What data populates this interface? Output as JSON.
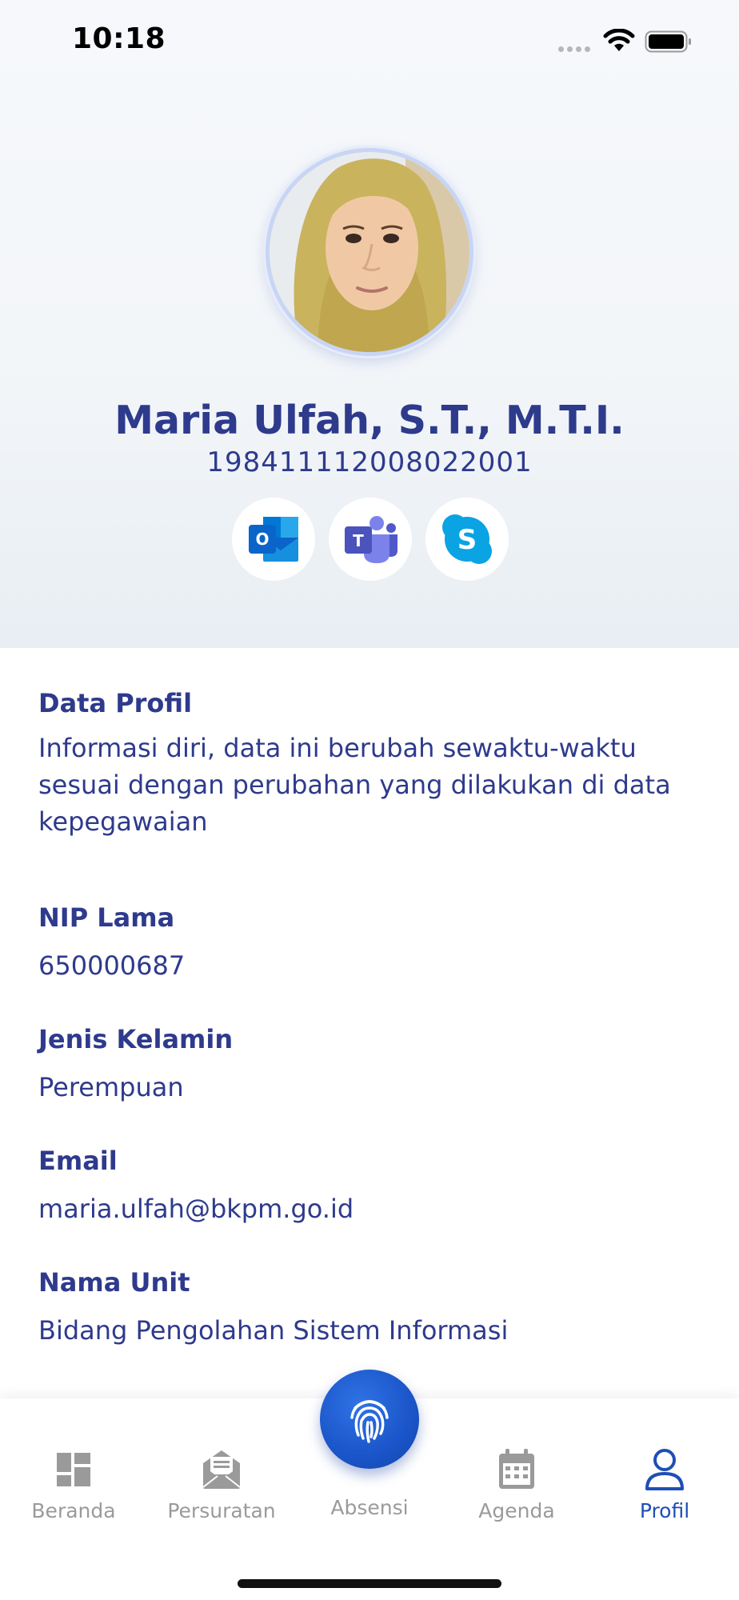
{
  "status_bar": {
    "time": "10:18"
  },
  "profile": {
    "name": "Maria Ulfah, S.T., M.T.I.",
    "nip": "198411112008022001",
    "apps": [
      {
        "name": "outlook",
        "icon": "outlook-icon",
        "letter": "O",
        "color": "#0a64c9"
      },
      {
        "name": "teams",
        "icon": "teams-icon",
        "letter": "T",
        "color": "#4b53bc"
      },
      {
        "name": "skype",
        "icon": "skype-icon",
        "letter": "S",
        "color": "#0aa3e3"
      }
    ]
  },
  "content": {
    "intro": {
      "title": "Data Profil",
      "description": "Informasi diri, data ini berubah sewaktu-waktu sesuai dengan perubahan yang dilakukan di data kepegawaian"
    },
    "fields": [
      {
        "label": "NIP Lama",
        "value": "650000687"
      },
      {
        "label": "Jenis Kelamin",
        "value": "Perempuan"
      },
      {
        "label": "Email",
        "value": "maria.ulfah@bkpm.go.id"
      },
      {
        "label": "Nama Unit",
        "value": "Bidang Pengolahan Sistem Informasi"
      }
    ]
  },
  "nav": {
    "items": [
      {
        "label": "Beranda",
        "icon": "dashboard-icon"
      },
      {
        "label": "Persuratan",
        "icon": "mail-icon"
      },
      {
        "label": "Absensi",
        "icon": "fingerprint-icon"
      },
      {
        "label": "Agenda",
        "icon": "calendar-icon"
      },
      {
        "label": "Profil",
        "icon": "user-icon"
      }
    ],
    "active": "Profil"
  },
  "colors": {
    "primary": "#2e3a8c",
    "accent": "#1e4fb5",
    "inactive": "#9a9a9a"
  }
}
